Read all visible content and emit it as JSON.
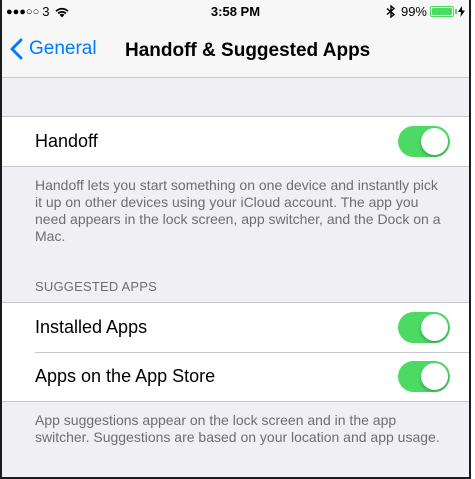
{
  "status_bar": {
    "signal_dots": "●●●○○",
    "carrier": "3",
    "time": "3:58 PM",
    "battery_percent": "99%",
    "battery_level": 0.99,
    "accent_color": "#4cd964"
  },
  "nav": {
    "back_label": "General",
    "title": "Handoff & Suggested Apps",
    "back_icon": "chevron-left-icon",
    "tint_color": "#007aff"
  },
  "handoff": {
    "label": "Handoff",
    "enabled": true,
    "footer": "Handoff lets you start something on one device and instantly pick it up on other devices using your iCloud account. The app you need appears in the lock screen, app switcher, and the Dock on a Mac."
  },
  "suggested_apps": {
    "header": "SUGGESTED APPS",
    "items": [
      {
        "label": "Installed Apps",
        "enabled": true
      },
      {
        "label": "Apps on the App Store",
        "enabled": true
      }
    ],
    "footer": "App suggestions appear on the lock screen and in the app switcher. Suggestions are based on your location and app usage."
  },
  "toggle_on_color": "#4cd964"
}
